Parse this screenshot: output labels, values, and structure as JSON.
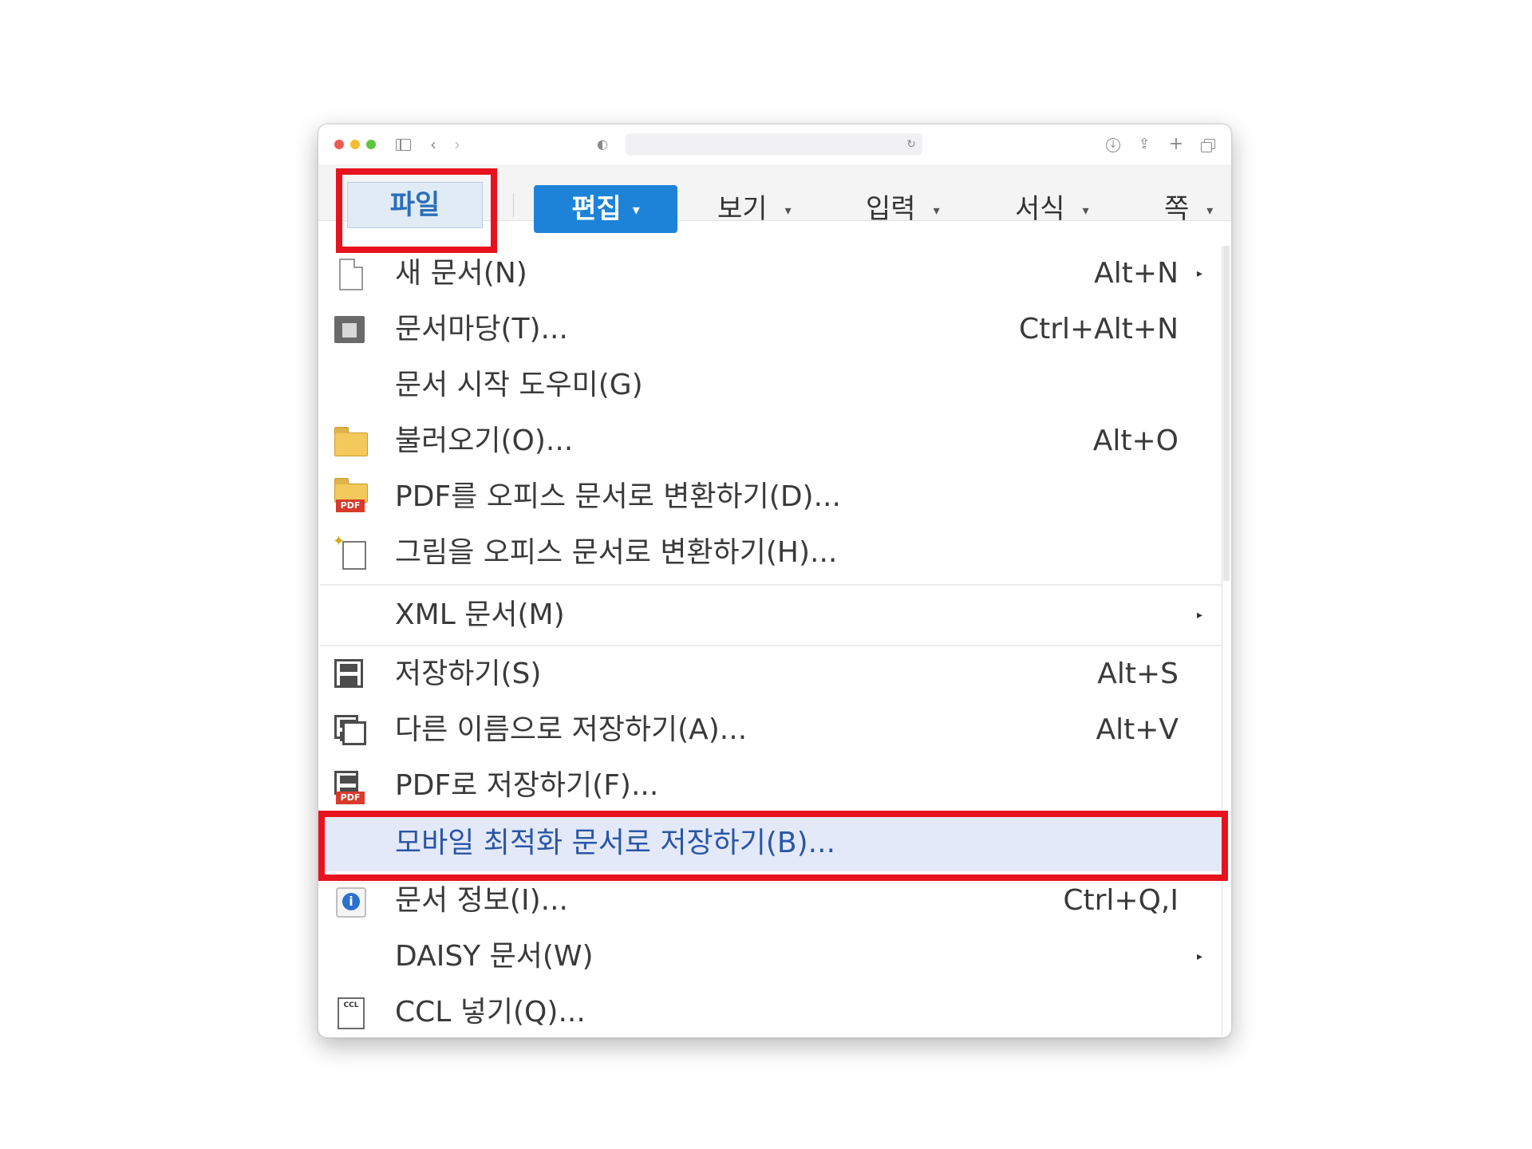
{
  "toolbar": {
    "tabs": [
      {
        "label": "파일",
        "caret": ""
      },
      {
        "label": "편집",
        "caret": "▾"
      },
      {
        "label": "보기",
        "caret": "▾"
      },
      {
        "label": "입력",
        "caret": "▾"
      },
      {
        "label": "서식",
        "caret": "▾"
      },
      {
        "label": "쪽",
        "caret": "▾"
      }
    ]
  },
  "menu": {
    "items": [
      {
        "label": "새 문서(N)",
        "shortcut": "Alt+N",
        "icon": "new-document-icon",
        "submenu": "▸"
      },
      {
        "label": "문서마당(T)...",
        "shortcut": "Ctrl+Alt+N",
        "icon": "template-icon",
        "submenu": ""
      },
      {
        "label": "문서 시작 도우미(G)",
        "shortcut": "",
        "icon": "",
        "submenu": ""
      },
      {
        "label": "불러오기(O)...",
        "shortcut": "Alt+O",
        "icon": "open-folder-icon",
        "submenu": ""
      },
      {
        "label": "PDF를 오피스 문서로 변환하기(D)...",
        "shortcut": "",
        "icon": "pdf-convert-icon",
        "submenu": ""
      },
      {
        "label": "그림을 오피스 문서로 변환하기(H)...",
        "shortcut": "",
        "icon": "image-convert-icon",
        "submenu": ""
      },
      {
        "label": "XML 문서(M)",
        "shortcut": "",
        "icon": "",
        "submenu": "▸"
      },
      {
        "label": "저장하기(S)",
        "shortcut": "Alt+S",
        "icon": "save-icon",
        "submenu": ""
      },
      {
        "label": "다른 이름으로 저장하기(A)...",
        "shortcut": "Alt+V",
        "icon": "save-as-icon",
        "submenu": ""
      },
      {
        "label": "PDF로 저장하기(F)...",
        "shortcut": "",
        "icon": "save-pdf-icon",
        "submenu": ""
      },
      {
        "label": "모바일 최적화 문서로 저장하기(B)...",
        "shortcut": "",
        "icon": "",
        "submenu": ""
      },
      {
        "label": "문서 정보(I)...",
        "shortcut": "Ctrl+Q,I",
        "icon": "info-icon",
        "submenu": ""
      },
      {
        "label": "DAISY 문서(W)",
        "shortcut": "",
        "icon": "",
        "submenu": "▸"
      },
      {
        "label": "CCL 넣기(Q)...",
        "shortcut": "",
        "icon": "ccl-icon",
        "submenu": ""
      }
    ]
  },
  "icons": {
    "pdf_tag": "PDF",
    "ccl_tag": "CCL"
  },
  "colors": {
    "highlight_red": "#e8121f",
    "edit_tab_blue": "#1d83d9",
    "selected_row": "#e3e9f8"
  }
}
